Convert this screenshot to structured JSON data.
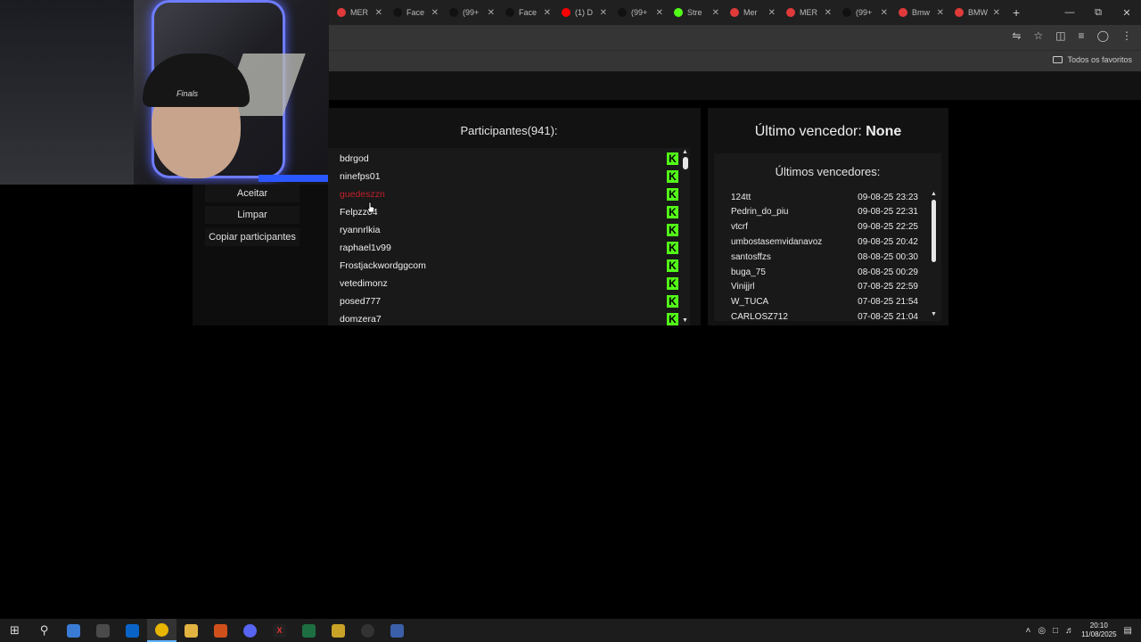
{
  "browser": {
    "tabs": [
      {
        "label": "MER",
        "icon": "kick-icon",
        "color": "#e03a3a"
      },
      {
        "label": "Face",
        "icon": "tiktok-icon",
        "color": "#111111"
      },
      {
        "label": "(99+",
        "icon": "tiktok-icon",
        "color": "#111111"
      },
      {
        "label": "Face",
        "icon": "tiktok-icon",
        "color": "#111111"
      },
      {
        "label": "(1) D",
        "icon": "youtube-icon",
        "color": "#ff0000"
      },
      {
        "label": "(99+",
        "icon": "tiktok-icon",
        "color": "#111111"
      },
      {
        "label": "Stre",
        "icon": "kick-icon",
        "color": "#53fc18"
      },
      {
        "label": "Mer",
        "icon": "kick-icon",
        "color": "#e03a3a"
      },
      {
        "label": "MER",
        "icon": "kick-icon",
        "color": "#e03a3a"
      },
      {
        "label": "(99+",
        "icon": "tiktok-icon",
        "color": "#111111"
      },
      {
        "label": "Bmw",
        "icon": "kick-icon",
        "color": "#e03a3a"
      },
      {
        "label": "BMW",
        "icon": "kick-icon",
        "color": "#e03a3a"
      }
    ],
    "bookmarks_all": "Todos os favoritos"
  },
  "left_buttons": {
    "accept": "Aceitar",
    "clear": "Limpar",
    "copy": "Copiar participantes"
  },
  "participants": {
    "title": "Participantes(941):",
    "items": [
      {
        "name": "bdrgod",
        "red": false
      },
      {
        "name": "ninefps01",
        "red": false
      },
      {
        "name": "guedeszzn",
        "red": true
      },
      {
        "name": "Felpzz04",
        "red": false
      },
      {
        "name": "ryannrlkia",
        "red": false
      },
      {
        "name": "raphael1v99",
        "red": false
      },
      {
        "name": "Frostjackwordggcom",
        "red": false
      },
      {
        "name": "vetedimonz",
        "red": false
      },
      {
        "name": "posed777",
        "red": false
      },
      {
        "name": "domzera7",
        "red": false
      }
    ],
    "badge": "K"
  },
  "winners": {
    "last_label": "Último vencedor:",
    "last_value": "None",
    "list_title": "Últimos vencedores:",
    "items": [
      {
        "name": "124tt",
        "date": "09-08-25 23:23"
      },
      {
        "name": "Pedrin_do_piu",
        "date": "09-08-25 22:31"
      },
      {
        "name": "vtcrf",
        "date": "09-08-25 22:25"
      },
      {
        "name": "umbostasemvidanavoz",
        "date": "09-08-25 20:42"
      },
      {
        "name": "santosffzs",
        "date": "08-08-25 00:30"
      },
      {
        "name": "buga_75",
        "date": "08-08-25 00:29"
      },
      {
        "name": "Vinijjrl",
        "date": "07-08-25 22:59"
      },
      {
        "name": "W_TUCA",
        "date": "07-08-25 21:54"
      },
      {
        "name": "CARLOSZ712",
        "date": "07-08-25 21:04"
      }
    ]
  },
  "webcam": {
    "cap_text": "Finals"
  },
  "taskbar": {
    "time": "20:10",
    "date": "11/08/2025"
  }
}
